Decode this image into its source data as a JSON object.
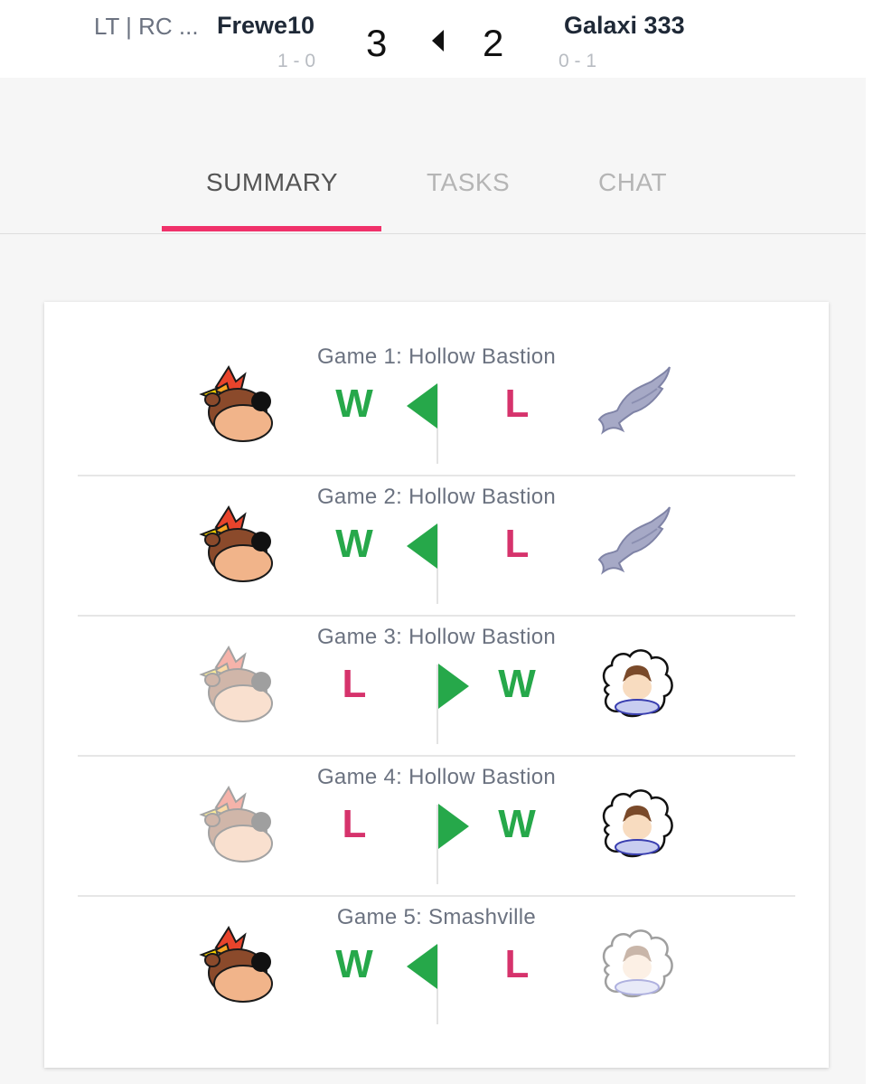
{
  "header": {
    "player1": {
      "team": "LT | RC ...",
      "name": "Frewe10",
      "record": "1 - 0",
      "score": "3"
    },
    "player2": {
      "name": "Galaxi 333",
      "record": "0 - 1",
      "score": "2"
    },
    "leader_indicator": "caret-left-icon"
  },
  "tabs": [
    {
      "label": "SUMMARY",
      "active": true
    },
    {
      "label": "TASKS",
      "active": false
    },
    {
      "label": "CHAT",
      "active": false
    }
  ],
  "accent_color": "#f0316a",
  "colors": {
    "win": "#26a84a",
    "loss": "#d6336c"
  },
  "games": [
    {
      "title": "Game 1: Hollow Bastion",
      "left_result": "W",
      "right_result": "L",
      "winner": "left",
      "left_character": "banjo-kazooie-icon",
      "right_character": "ridley-icon"
    },
    {
      "title": "Game 2: Hollow Bastion",
      "left_result": "W",
      "right_result": "L",
      "winner": "left",
      "left_character": "banjo-kazooie-icon",
      "right_character": "ridley-icon"
    },
    {
      "title": "Game 3: Hollow Bastion",
      "left_result": "L",
      "right_result": "W",
      "winner": "right",
      "left_character": "banjo-kazooie-icon",
      "right_character": "ice-climbers-icon"
    },
    {
      "title": "Game 4: Hollow Bastion",
      "left_result": "L",
      "right_result": "W",
      "winner": "right",
      "left_character": "banjo-kazooie-icon",
      "right_character": "ice-climbers-icon"
    },
    {
      "title": "Game 5: Smashville",
      "left_result": "W",
      "right_result": "L",
      "winner": "left",
      "left_character": "banjo-kazooie-icon",
      "right_character": "ice-climbers-icon"
    }
  ]
}
